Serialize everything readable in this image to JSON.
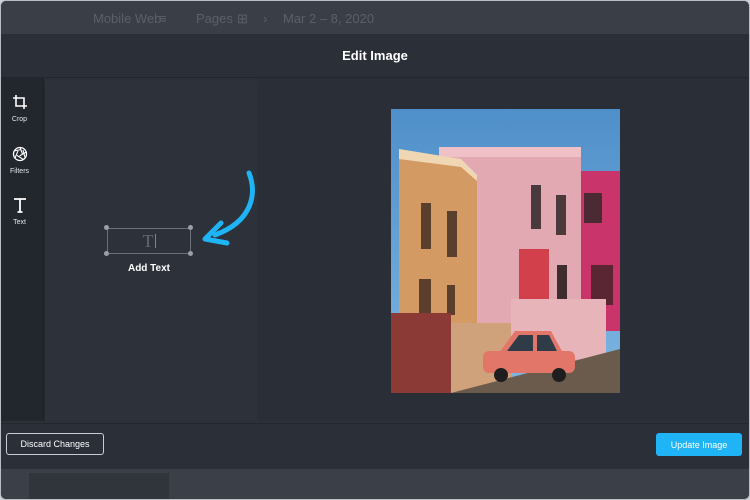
{
  "background_page": {
    "items": [
      "Mobile Web",
      "≡",
      "Pages",
      "⊞",
      "›",
      "Mar 2 – 8, 2020"
    ]
  },
  "modal": {
    "title": "Edit Image"
  },
  "tools": [
    {
      "label": "Crop",
      "icon": "crop-icon"
    },
    {
      "label": "Filters",
      "icon": "aperture-icon"
    },
    {
      "label": "Text",
      "icon": "text-t-icon"
    }
  ],
  "panel": {
    "text_box_glyph": "T",
    "add_text_label": "Add Text"
  },
  "footer": {
    "discard_label": "Discard Changes",
    "update_label": "Update Image"
  },
  "colors": {
    "accent": "#1eb4f5",
    "modal_bg": "#2a2f38"
  }
}
